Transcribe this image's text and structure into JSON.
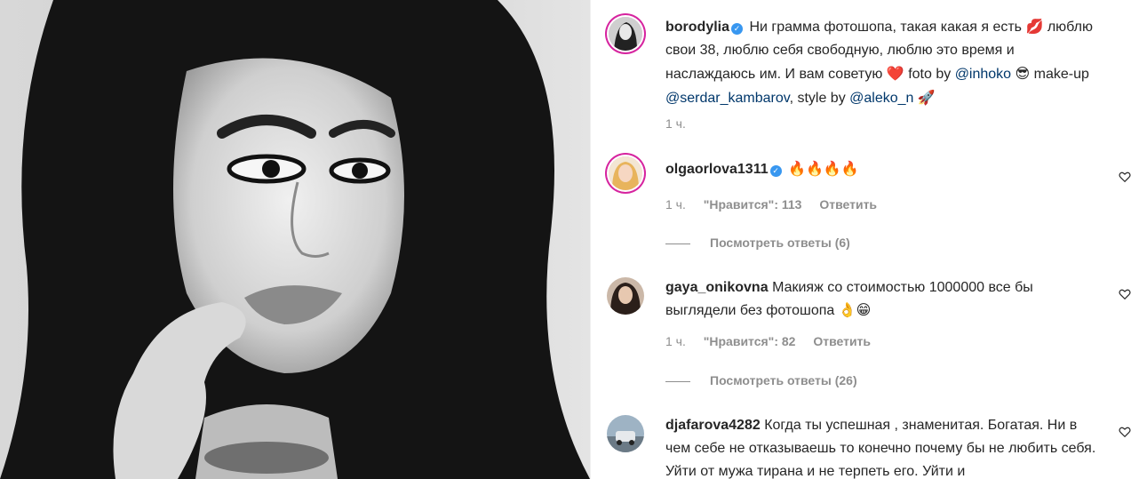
{
  "post": {
    "username": "borodylia",
    "caption_parts": [
      {
        "text": "Ни грамма фотошопа, такая какая я есть "
      },
      {
        "emoji": "💋"
      },
      {
        "text": " люблю свои 38, люблю себя свободную, люблю это время и наслаждаюсь им. И вам советую "
      },
      {
        "emoji": "❤️"
      },
      {
        "text": " foto by "
      },
      {
        "mention": "@inhoko"
      },
      {
        "text": " "
      },
      {
        "emoji": "😎"
      },
      {
        "text": " make-up "
      },
      {
        "mention": "@serdar_kambarov"
      },
      {
        "text": ", style by "
      },
      {
        "mention": "@aleko_n"
      },
      {
        "text": " "
      },
      {
        "emoji": "🚀"
      }
    ],
    "time": "1 ч."
  },
  "comments": [
    {
      "username": "olgaorlova1311",
      "verified": true,
      "text": "🔥🔥🔥🔥",
      "time": "1 ч.",
      "likes": "\"Нравится\": 113",
      "reply": "Ответить",
      "view_replies": "Посмотреть ответы (6)"
    },
    {
      "username": "gaya_onikovna",
      "verified": false,
      "text": "Макияж со стоимостью 1000000 все бы выглядели без фотошопа 👌😁",
      "time": "1 ч.",
      "likes": "\"Нравится\": 82",
      "reply": "Ответить",
      "view_replies": "Посмотреть ответы (26)"
    },
    {
      "username": "djafarova4282",
      "verified": false,
      "text": "Когда ты успешная , знаменитая. Богатая. Ни в чем себе не отказываешь то конечно почему бы не любить себя. Уйти от мужа тирана и не терпеть его. Уйти и"
    }
  ],
  "colors": {
    "link": "#00376b",
    "meta": "#8e8e8e",
    "verified": "#3897f0"
  },
  "icons": [
    "heart-outline-icon",
    "verified-badge-icon"
  ]
}
